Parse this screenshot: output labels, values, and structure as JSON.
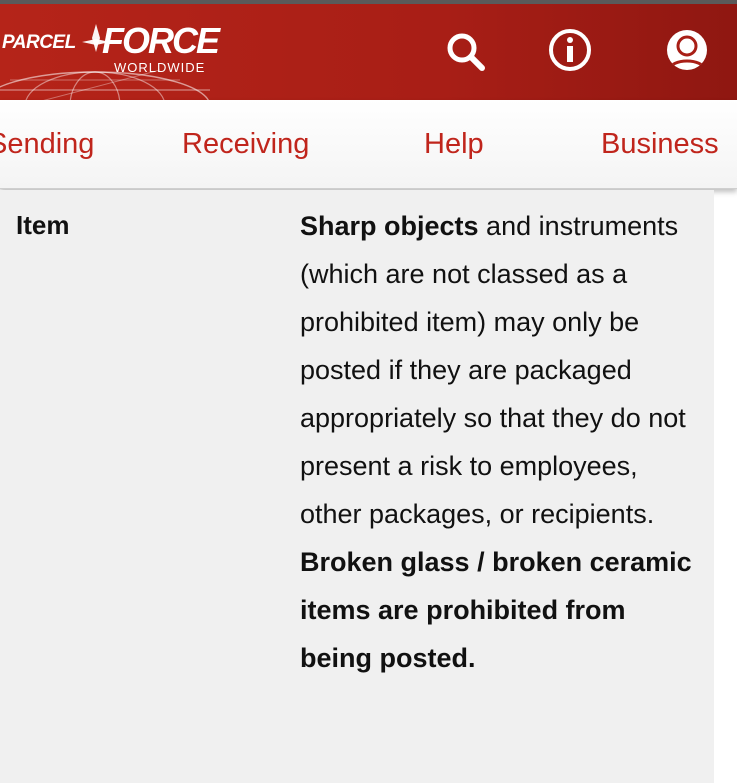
{
  "header": {
    "logo": {
      "text_left": "PARCEL",
      "text_right": "FORCE",
      "subtext": "WORLDWIDE"
    },
    "icons": [
      "search-icon",
      "info-icon",
      "account-icon"
    ],
    "colors": {
      "brand_red": "#b52419",
      "link_red": "#c0251c"
    }
  },
  "nav": {
    "items": [
      {
        "label": "Sending"
      },
      {
        "label": "Receiving"
      },
      {
        "label": "Help"
      },
      {
        "label": "Business"
      }
    ]
  },
  "table": {
    "row_label": "Item",
    "description": {
      "lead_bold": "Sharp objects",
      "body": " and instruments (which are not classed as a prohibited item) may only be posted if they are packaged appropriately so that they do not present a risk to employees, other packages, or recipients.",
      "warning_bold": "Broken glass / broken ceramic items are prohibited from being posted."
    }
  }
}
